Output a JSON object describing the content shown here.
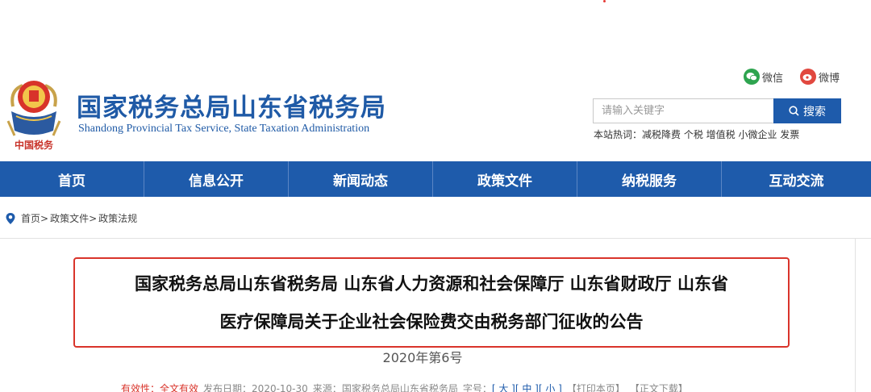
{
  "header": {
    "title": "国家税务总局山东省税务局",
    "subtitle": "Shandong Provincial Tax Service, State Taxation Administration",
    "emblem_text": "中国税务"
  },
  "social": {
    "wechat": "微信",
    "weibo": "微博"
  },
  "search": {
    "placeholder": "请输入关键字",
    "button": "搜索",
    "hot_label": "本站热词：",
    "hot_terms": "减税降费 个税 增值税 小微企业 发票"
  },
  "nav": {
    "items": [
      "首页",
      "信息公开",
      "新闻动态",
      "政策文件",
      "纳税服务",
      "互动交流"
    ]
  },
  "breadcrumb": {
    "items": [
      "首页>",
      "政策文件>",
      "政策法规"
    ]
  },
  "article": {
    "title_line1": "国家税务总局山东省税务局 山东省人力资源和社会保障厅 山东省财政厅 山东省",
    "title_line2": "医疗保障局关于企业社会保险费交由税务部门征收的公告",
    "number": "2020年第6号",
    "meta": {
      "validity_label": "有效性：",
      "validity_value": "全文有效",
      "date_label": "发布日期：",
      "date_value": "2020-10-30",
      "source_label": "来源：",
      "source_value": "国家税务总局山东省税务局",
      "size_label": "字号：",
      "size_large": "[ 大 ]",
      "size_medium": "[ 中 ]",
      "size_small": "[ 小 ]",
      "print": "【打印本页】",
      "download": "【正文下载】"
    }
  },
  "colors": {
    "brand_blue": "#1e5bab",
    "highlight_red": "#d9342b"
  }
}
